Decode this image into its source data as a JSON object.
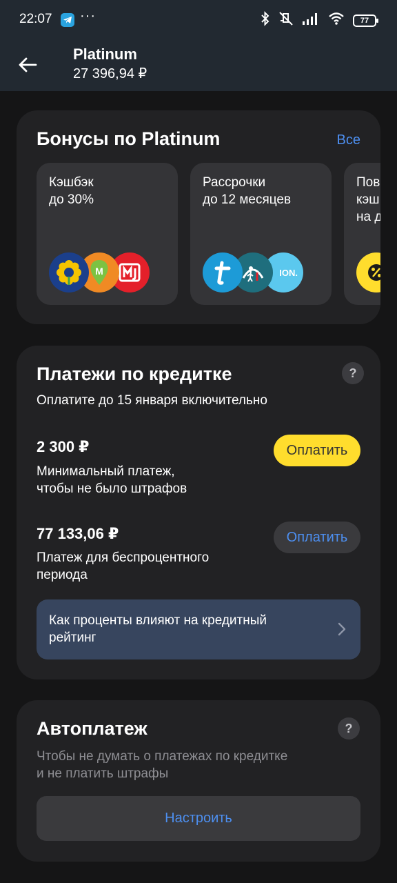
{
  "status_bar": {
    "time": "22:07",
    "more": "···",
    "battery": "77",
    "icons": [
      "telegram-icon",
      "bluetooth-icon",
      "mute-icon",
      "signal-icon",
      "wifi-icon",
      "battery-icon"
    ]
  },
  "header": {
    "title": "Platinum",
    "balance": "27 396,94 ₽",
    "back_icon": "arrow-left-icon"
  },
  "bonuses": {
    "title": "Бонусы по Platinum",
    "all_link": "Все",
    "tiles": [
      {
        "line1": "Кэшбэк",
        "line2": "до 30%",
        "logos": [
          "sunflower-logo",
          "m-logo",
          "mj-logo"
        ]
      },
      {
        "line1": "Рассрочки",
        "line2": "до 12 месяцев",
        "logos": [
          "t-logo",
          "pedestrian-logo",
          "ion-logo"
        ],
        "logo3_text": "ION."
      },
      {
        "line1": "Пов",
        "line2": "кэш",
        "line3": "на д",
        "logos": [
          "percent-logo"
        ]
      }
    ]
  },
  "payments": {
    "title": "Платежи по кредитке",
    "help": "?",
    "subtitle": "Оплатите до 15 января включительно",
    "min_amount": "2 300 ₽",
    "min_desc_line1": "Минимальный платеж,",
    "min_desc_line2": "чтобы не было штрафов",
    "min_button": "Оплатить",
    "full_amount": "77 133,06 ₽",
    "full_desc_line1": "Платеж для беспроцентного",
    "full_desc_line2": "периода",
    "full_button": "Оплатить",
    "rating_line1": "Как проценты влияют на кредитный",
    "rating_line2": "рейтинг"
  },
  "autopay": {
    "title": "Автоплатеж",
    "help": "?",
    "desc_line1": "Чтобы не думать о платежах по кредитке",
    "desc_line2": "и не платить штрафы",
    "button": "Настроить"
  },
  "colors": {
    "background": "#151516",
    "header": "#222931",
    "card": "#222224",
    "tile": "#343437",
    "accent_blue": "#4D8FF0",
    "accent_yellow": "#FFDD2D",
    "rating_bg": "#37455E"
  }
}
